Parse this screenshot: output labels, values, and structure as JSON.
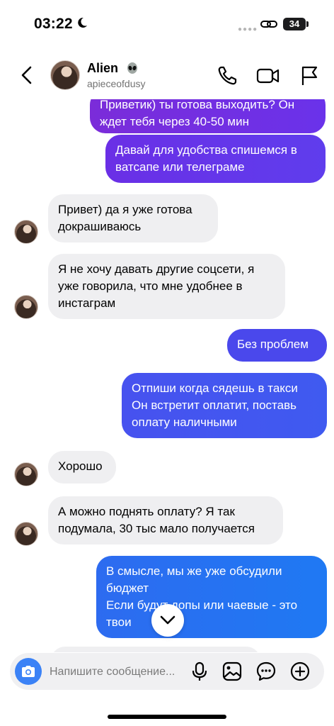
{
  "status_bar": {
    "time": "03:22",
    "battery": "34"
  },
  "header": {
    "name": "Alien",
    "username": "apieceofdusy"
  },
  "messages": [
    {
      "lines": [
        "Приветик) ты готова выходить? Он",
        "ждет тебя через 40-50 мин"
      ]
    },
    {
      "lines": [
        "Давай для удобства спишемся в",
        "ватсапе или телеграме"
      ]
    },
    {
      "lines": [
        "Привет) да я уже готова",
        "докрашиваюсь"
      ]
    },
    {
      "lines": [
        "Я не хочу давать другие соцсети, я",
        "уже говорила, что мне удобнее в",
        "инстаграм"
      ]
    },
    {
      "lines": [
        "Без проблем"
      ]
    },
    {
      "lines": [
        "Отпиши когда сядешь в такси",
        "Он встретит оплатит, поставь",
        "оплату наличными"
      ]
    },
    {
      "lines": [
        "Хорошо"
      ]
    },
    {
      "lines": [
        "А можно поднять оплату? Я так",
        "подумала, 30 тыс мало получается"
      ]
    },
    {
      "lines": [
        "В смысле, мы же уже обсудили",
        "бюджет",
        "Если будут допы или чаевые - это",
        "твои"
      ]
    }
  ],
  "composer": {
    "placeholder": "Напишите сообщение..."
  },
  "colors": {
    "incoming": "#efeff1",
    "outgoing_purple": "#6a2fe6",
    "outgoing_blue": "#3e5bf0",
    "accent": "#3b82f6"
  }
}
